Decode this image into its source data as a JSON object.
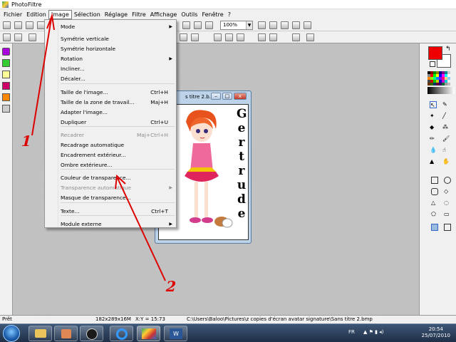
{
  "window": {
    "title": "PhotoFiltre"
  },
  "menubar": {
    "items": [
      "Fichier",
      "Edition",
      "Image",
      "Sélection",
      "Réglage",
      "Filtre",
      "Affichage",
      "Outils",
      "Fenêtre",
      "?"
    ],
    "active": "Image"
  },
  "toolbar": {
    "zoom": "100%"
  },
  "image_menu": {
    "items": [
      {
        "label": "Mode",
        "shortcut": "",
        "submenu": true,
        "disabled": false
      },
      {
        "label": "Symétrie verticale",
        "shortcut": "",
        "submenu": false,
        "disabled": false
      },
      {
        "label": "Symétrie horizontale",
        "shortcut": "",
        "submenu": false,
        "disabled": false
      },
      {
        "label": "Rotation",
        "shortcut": "",
        "submenu": true,
        "disabled": false
      },
      {
        "label": "Incliner...",
        "shortcut": "",
        "submenu": false,
        "disabled": false
      },
      {
        "label": "Décaler...",
        "shortcut": "",
        "submenu": false,
        "disabled": false
      },
      {
        "label": "Taille de l'image...",
        "shortcut": "Ctrl+H",
        "submenu": false,
        "disabled": false
      },
      {
        "label": "Taille de la zone de travail...",
        "shortcut": "Maj+H",
        "submenu": false,
        "disabled": false
      },
      {
        "label": "Adapter l'image...",
        "shortcut": "",
        "submenu": false,
        "disabled": false
      },
      {
        "label": "Dupliquer",
        "shortcut": "Ctrl+U",
        "submenu": false,
        "disabled": false
      },
      {
        "label": "Recadrer",
        "shortcut": "Maj+Ctrl+H",
        "submenu": false,
        "disabled": true
      },
      {
        "label": "Recadrage automatique",
        "shortcut": "",
        "submenu": false,
        "disabled": false
      },
      {
        "label": "Encadrement extérieur...",
        "shortcut": "",
        "submenu": false,
        "disabled": false
      },
      {
        "label": "Ombre extérieure...",
        "shortcut": "",
        "submenu": false,
        "disabled": false
      },
      {
        "label": "Couleur de transparence...",
        "shortcut": "",
        "submenu": false,
        "disabled": false
      },
      {
        "label": "Transparence automatique",
        "shortcut": "",
        "submenu": true,
        "disabled": true
      },
      {
        "label": "Masque de transparence...",
        "shortcut": "",
        "submenu": false,
        "disabled": false
      },
      {
        "label": "Texte...",
        "shortcut": "Ctrl+T",
        "submenu": false,
        "disabled": false
      },
      {
        "label": "Module externe",
        "shortcut": "",
        "submenu": true,
        "disabled": false
      }
    ]
  },
  "image_window": {
    "title": "s titre 2.b...",
    "text_letters": [
      "G",
      "e",
      "r",
      "t",
      "r",
      "u",
      "d",
      "e"
    ]
  },
  "statusbar": {
    "state": "Prêt",
    "dimensions": "182x289x16M",
    "coords": "X:Y = 15:73",
    "path": "C:\\Users\\Baloo\\Pictures\\z copies d'écran avatar signature\\Sans titre 2.bmp"
  },
  "taskbar": {
    "lang": "FR",
    "time": "20:54",
    "date": "25/07/2010"
  },
  "annotations": {
    "one": "1",
    "two": "2",
    "color": "#dd0000"
  },
  "colors": {
    "foreground": "#ee0000",
    "background": "#ffffff"
  }
}
